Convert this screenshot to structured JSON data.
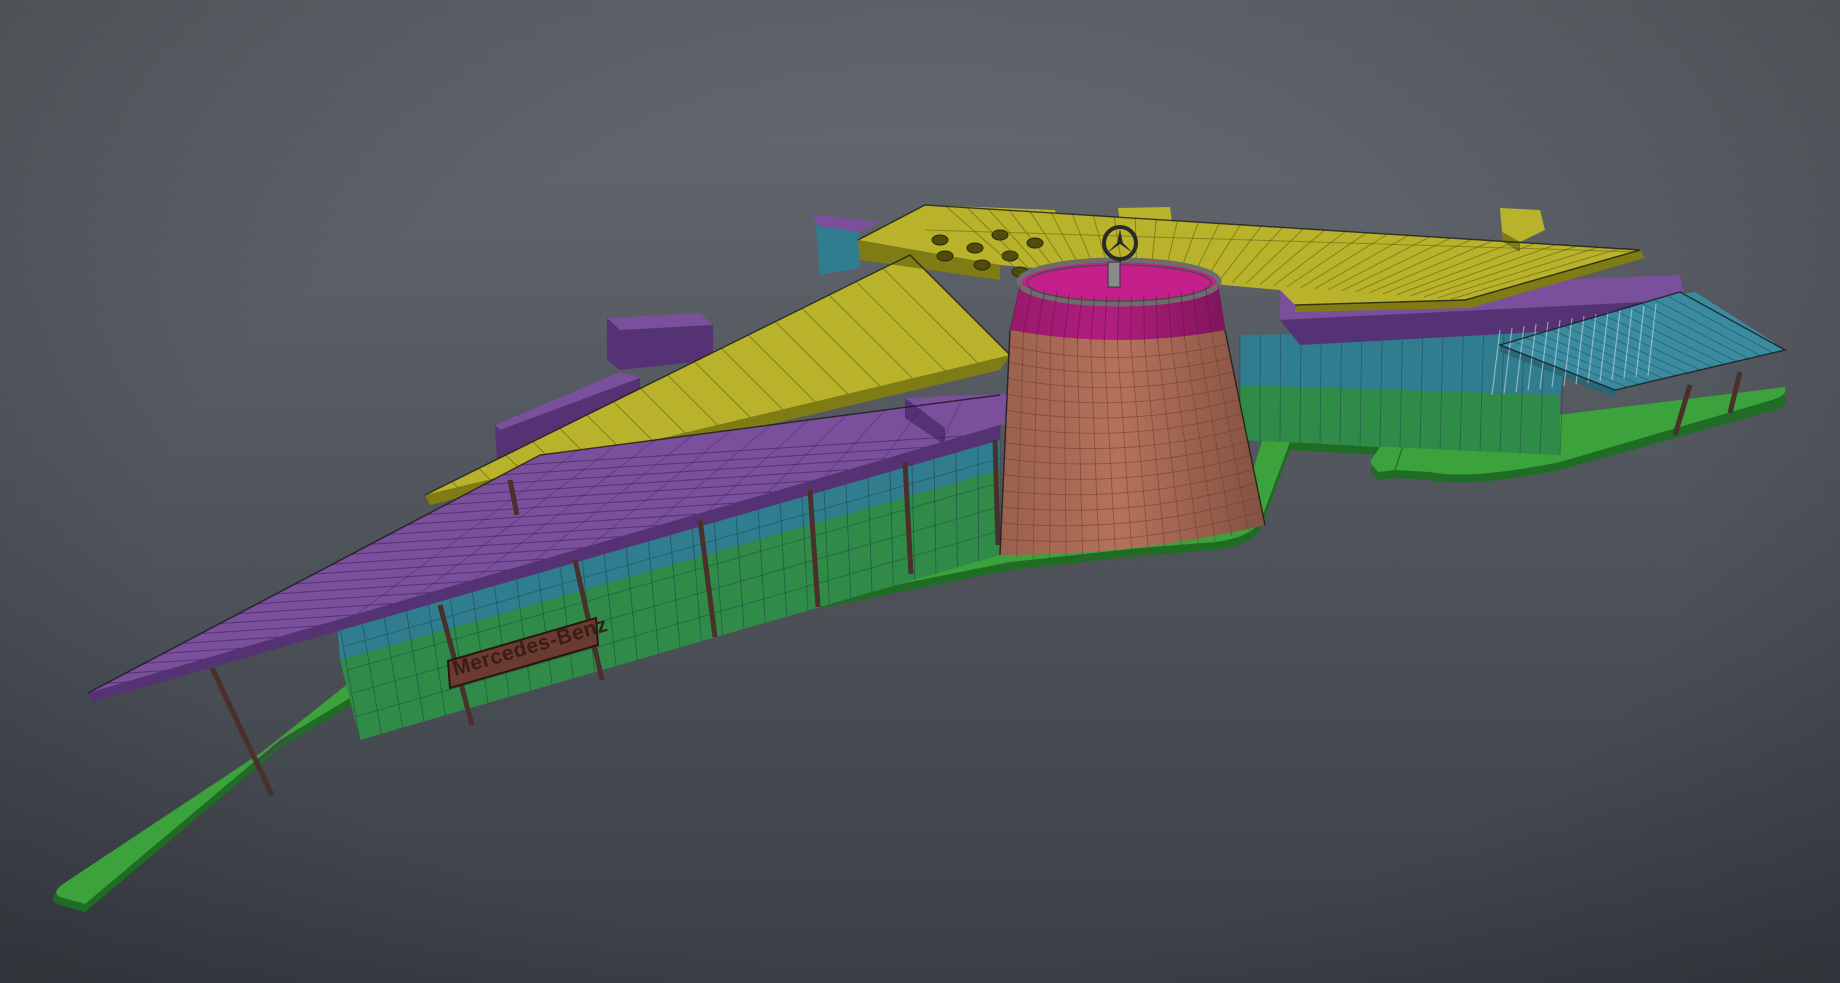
{
  "scene": {
    "colors": {
      "background_top": "#676b72",
      "background_bottom": "#3b3f46",
      "ground": "#3ca23c",
      "ground_edge": "#1f6d25",
      "wall_blue": "#2f7d8e",
      "wall_green": "#2f8b47",
      "roof_purple": "#7a4f9b",
      "roof_purple_dark": "#553273",
      "roof_yellow": "#b8b32a",
      "roof_yellow_dark": "#7f7b15",
      "tower_salmon": "#b5725b",
      "tower_magenta": "#b11e7e",
      "canopy_blue": "#3a8aa0",
      "post": "#4a2f2a",
      "emblem": "#2a2a2a"
    },
    "sign": {
      "text": "Mercedes-Benz"
    },
    "icons": {
      "emblem": "three-pointed-star-icon"
    }
  }
}
